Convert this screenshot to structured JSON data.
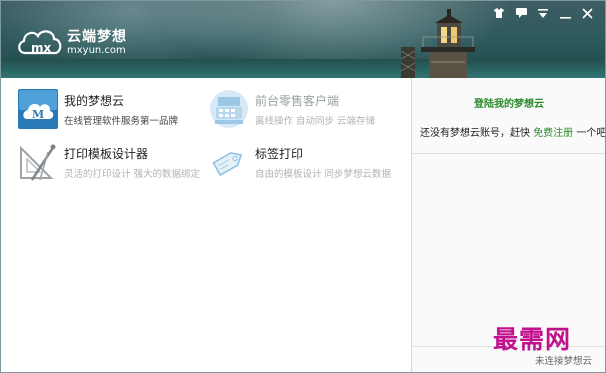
{
  "brand": {
    "name": "云端梦想",
    "domain": "mxyun.com",
    "logo_letters": "mx"
  },
  "window_controls": [
    "shirt-icon",
    "chat-icon",
    "menu-icon",
    "minimize-icon",
    "close-icon"
  ],
  "apps": [
    {
      "title": "我的梦想云",
      "desc": "在线管理软件服务第一品牌",
      "icon": "cloud-m-icon",
      "state": "active"
    },
    {
      "title": "前台零售客户端",
      "desc": "离线操作 自动同步 云端存储",
      "icon": "cash-register-icon",
      "state": "disabled"
    },
    {
      "title": "打印模板设计器",
      "desc": "灵活的打印设计 强大的数据绑定",
      "icon": "drafting-tools-icon",
      "state": "dim"
    },
    {
      "title": "标签打印",
      "desc": "自由的模板设计 同步梦想云数据",
      "icon": "tag-icon",
      "state": "dim"
    }
  ],
  "side_panel": {
    "login_link": "登陆我的梦想云",
    "signup_prefix": "还没有梦想云账号，赶快",
    "signup_link": "免费注册",
    "signup_suffix": "一个吧"
  },
  "footer_text": "未连接梦想云",
  "watermark": "最需网",
  "colors": {
    "header": "#2f5a5e",
    "accent_green": "#2d8a2d",
    "watermark": "#c1128d"
  }
}
